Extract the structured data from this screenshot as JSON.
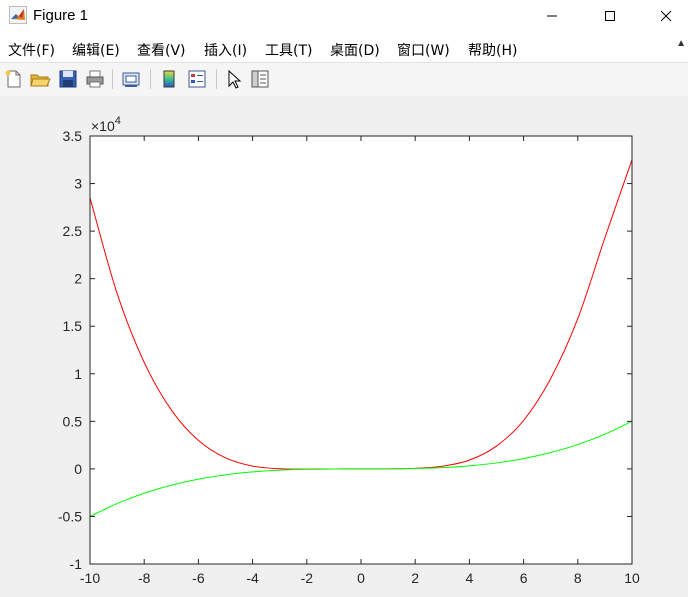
{
  "window": {
    "title": "Figure 1",
    "icon": "matlab-icon",
    "controls": [
      "minimize-icon",
      "maximize-icon",
      "close-icon"
    ]
  },
  "menu": {
    "items": [
      {
        "label": "文件(F)"
      },
      {
        "label": "编辑(E)"
      },
      {
        "label": "查看(V)"
      },
      {
        "label": "插入(I)"
      },
      {
        "label": "工具(T)"
      },
      {
        "label": "桌面(D)"
      },
      {
        "label": "窗口(W)"
      },
      {
        "label": "帮助(H)"
      }
    ]
  },
  "toolbar": {
    "buttons": [
      "new-figure-icon",
      "open-file-icon",
      "save-icon",
      "print-icon",
      "link-plot-icon",
      "insert-colorbar-icon",
      "insert-legend-icon",
      "edit-plot-icon",
      "property-inspector-icon"
    ]
  },
  "chart_data": {
    "type": "line",
    "xlim": [
      -10,
      10
    ],
    "ylim": [
      -10000,
      35000
    ],
    "y_exponent_label": "×10",
    "y_exponent": "4",
    "x_ticks": [
      -10,
      -8,
      -6,
      -4,
      -2,
      0,
      2,
      4,
      6,
      8,
      10
    ],
    "x_tick_labels": [
      "-10",
      "-8",
      "-6",
      "-4",
      "-2",
      "0",
      "2",
      "4",
      "6",
      "8",
      "10"
    ],
    "y_ticks": [
      -10000,
      -5000,
      0,
      5000,
      10000,
      15000,
      20000,
      25000,
      30000,
      35000
    ],
    "y_tick_labels": [
      "-1",
      "-0.5",
      "0",
      "0.5",
      "1",
      "1.5",
      "2",
      "2.5",
      "3",
      "3.5"
    ],
    "grid": false,
    "colors": {
      "red": "#ff0000",
      "green": "#00ff00"
    },
    "series": [
      {
        "color": "#ff0000",
        "x": [
          -10,
          -9,
          -8,
          -7,
          -6,
          -5,
          -4,
          -3,
          -2,
          -1,
          0,
          1,
          2,
          3,
          4,
          5,
          6,
          7,
          8,
          9,
          10
        ],
        "y": [
          28500,
          18450,
          11200,
          6200,
          3000,
          1160,
          290,
          10,
          -30,
          -5,
          0,
          7,
          60,
          280,
          920,
          2400,
          5100,
          9500,
          15800,
          24300,
          32500
        ]
      },
      {
        "color": "#00ff00",
        "x": [
          -10,
          -9,
          -8,
          -7,
          -6,
          -5,
          -4,
          -3,
          -2,
          -1,
          0,
          1,
          2,
          3,
          4,
          5,
          6,
          7,
          8,
          9,
          10
        ],
        "y": [
          -5000,
          -3650,
          -2560,
          -1720,
          -1080,
          -625,
          -320,
          -135,
          -40,
          -5,
          0,
          5,
          40,
          135,
          320,
          625,
          1080,
          1720,
          2560,
          3650,
          5000
        ]
      }
    ]
  }
}
